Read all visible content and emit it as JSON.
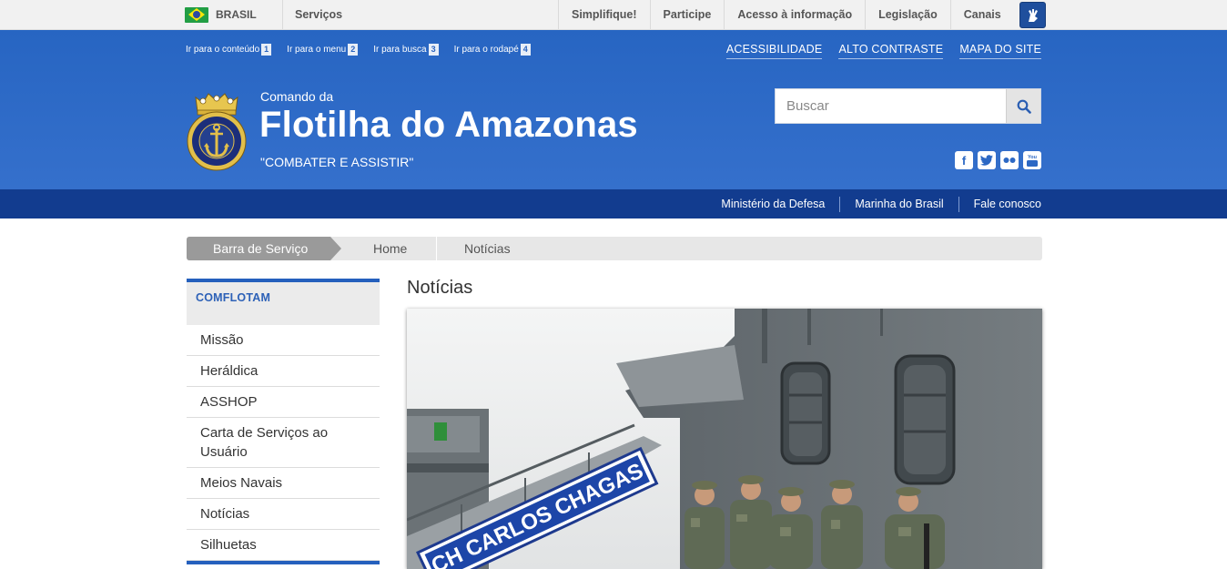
{
  "gov_bar": {
    "country": "BRASIL",
    "services": "Serviços",
    "links": [
      "Simplifique!",
      "Participe",
      "Acesso à informação",
      "Legislação",
      "Canais"
    ]
  },
  "skip_links": [
    {
      "label": "Ir para o conteúdo",
      "key": "1"
    },
    {
      "label": "Ir para o menu",
      "key": "2"
    },
    {
      "label": "Ir para busca",
      "key": "3"
    },
    {
      "label": "Ir para o rodapé",
      "key": "4"
    }
  ],
  "accessibility_links": [
    "ACESSIBILIDADE",
    "ALTO CONTRASTE",
    "MAPA DO SITE"
  ],
  "site": {
    "pre_title": "Comando da",
    "title": "Flotilha do Amazonas",
    "motto": "\"COMBATER E ASSISTIR\""
  },
  "search": {
    "placeholder": "Buscar"
  },
  "social_icons": [
    "facebook-icon",
    "twitter-icon",
    "flickr-icon",
    "youtube-icon"
  ],
  "top_nav": [
    "Ministério da Defesa",
    "Marinha do Brasil",
    "Fale conosco"
  ],
  "breadcrumb": {
    "label": "Barra de Serviço",
    "items": [
      "Home",
      "Notícias"
    ]
  },
  "sidebar": {
    "heading": "COMFLOTAM",
    "items": [
      "Missão",
      "Heráldica",
      "ASSHOP",
      "Carta de Serviços ao Usuário",
      "Meios Navais",
      "Notícias",
      "Silhuetas"
    ]
  },
  "main": {
    "title": "Notícias",
    "photo_sign": "CH CARLOS CHAGAS"
  },
  "colors": {
    "header_blue": "#2a67c3",
    "dark_blue": "#123c8f",
    "accent": "#2560bd"
  }
}
